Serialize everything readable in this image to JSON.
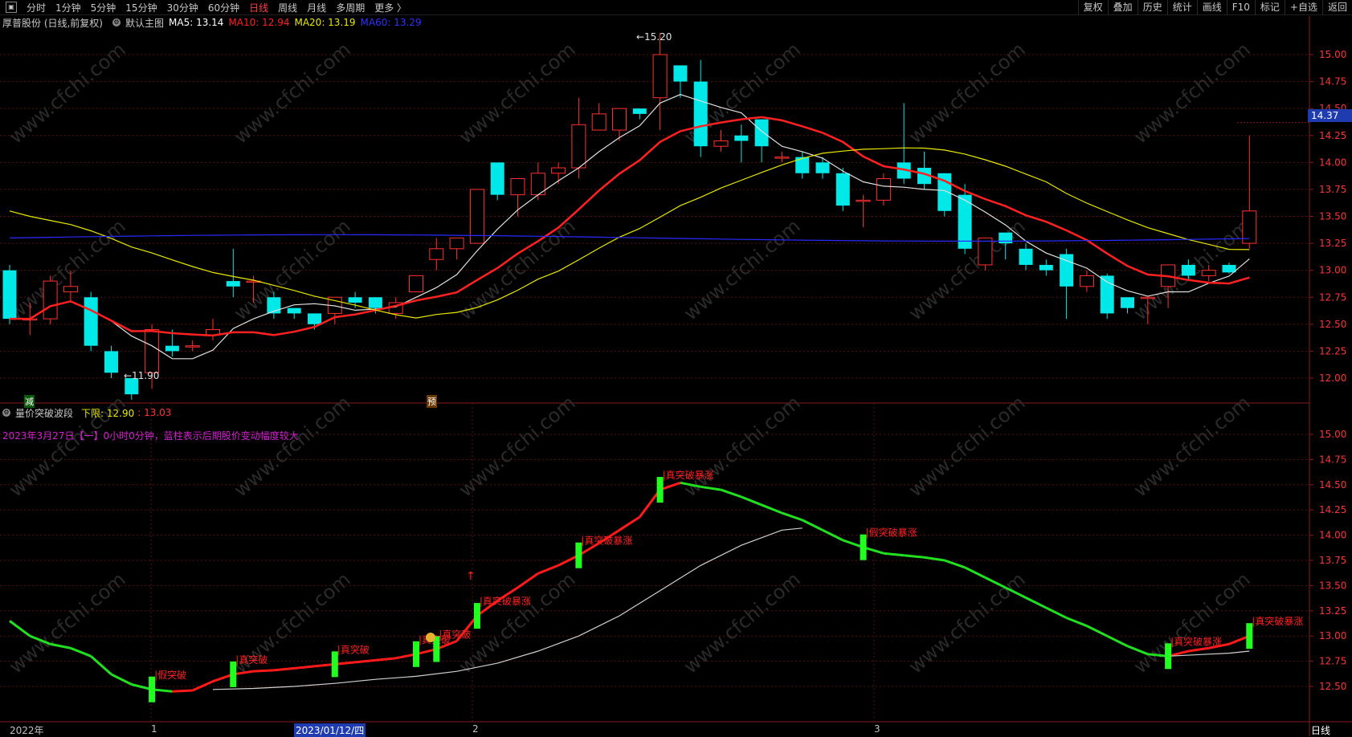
{
  "topbar": {
    "menu": [
      "分时",
      "1分钟",
      "5分钟",
      "15分钟",
      "30分钟",
      "60分钟",
      "日线",
      "周线",
      "月线",
      "多周期",
      "更多 〉"
    ],
    "active_index": 6,
    "right": [
      "复权",
      "叠加",
      "历史",
      "统计",
      "画线",
      "F10",
      "标记",
      "+自选",
      "返回"
    ]
  },
  "main_info": {
    "stock": "厚普股份 (日线,前复权)",
    "chart_name": "默认主图",
    "ma5": "MA5: 13.14",
    "ma10": "MA10: 12.94",
    "ma20": "MA20: 13.19",
    "ma60": "MA60: 13.29",
    "colors": {
      "ma5": "#ffffff",
      "ma10": "#ff2020",
      "ma20": "#e8e800",
      "ma60": "#2020ff"
    }
  },
  "price_axis_top": [
    "15.00",
    "14.75",
    "14.50",
    "14.25",
    "14.00",
    "13.75",
    "13.50",
    "13.25",
    "13.00",
    "12.75",
    "12.50",
    "12.25",
    "12.00"
  ],
  "price_axis_bottom": [
    "15.00",
    "14.75",
    "14.50",
    "14.25",
    "14.00",
    "13.75",
    "13.50",
    "13.25",
    "13.00",
    "12.75",
    "12.50"
  ],
  "current_price": "14.37",
  "high_label": "15.20",
  "low_label": "11.90",
  "markers": {
    "jian": "减",
    "yu": "预"
  },
  "sub_info": {
    "name": "量价突破波段",
    "lower_label": "下限: 12.90",
    "lower_value": ": 13.03",
    "note": "2023年3月27日【一】0小时0分钟，蓝柱表示后期股价变动幅度较大"
  },
  "signals": [
    "假突破",
    "真突破",
    "真突破",
    "真突破",
    "真突破暴涨",
    "真突破暴涨",
    "真突破暴涨",
    "假突破暴涨",
    "真突破暴涨",
    "真突破暴涨"
  ],
  "date_axis": {
    "year": "2022年",
    "m1": "1",
    "selected": "2023/01/12/四",
    "m2": "2",
    "m3": "3"
  },
  "period_label": "日线",
  "watermark": "www.cfchi.com",
  "chart_data": {
    "type": "candlestick",
    "ylim": [
      11.8,
      15.3
    ],
    "candles": [
      [
        13.0,
        12.55,
        12.5,
        13.05
      ],
      [
        12.55,
        12.55,
        12.4,
        12.7
      ],
      [
        12.55,
        12.9,
        12.5,
        12.95
      ],
      [
        12.8,
        12.85,
        12.7,
        13.0
      ],
      [
        12.75,
        12.3,
        12.25,
        12.8
      ],
      [
        12.25,
        12.05,
        12.0,
        12.3
      ],
      [
        12.0,
        11.85,
        11.8,
        12.0
      ],
      [
        12.05,
        12.45,
        11.9,
        12.5
      ],
      [
        12.3,
        12.25,
        12.2,
        12.45
      ],
      [
        12.3,
        12.3,
        12.25,
        12.35
      ],
      [
        12.4,
        12.45,
        12.35,
        12.55
      ],
      [
        12.9,
        12.85,
        12.75,
        13.2
      ],
      [
        12.9,
        12.9,
        12.7,
        12.95
      ],
      [
        12.75,
        12.6,
        12.55,
        12.8
      ],
      [
        12.65,
        12.6,
        12.55,
        12.65
      ],
      [
        12.6,
        12.5,
        12.45,
        12.6
      ],
      [
        12.6,
        12.75,
        12.5,
        12.75
      ],
      [
        12.75,
        12.7,
        12.65,
        12.8
      ],
      [
        12.75,
        12.65,
        12.6,
        12.75
      ],
      [
        12.6,
        12.7,
        12.55,
        12.75
      ],
      [
        12.8,
        12.95,
        12.8,
        12.95
      ],
      [
        13.1,
        13.2,
        13.0,
        13.3
      ],
      [
        13.2,
        13.3,
        13.1,
        13.3
      ],
      [
        13.25,
        13.75,
        13.25,
        13.75
      ],
      [
        14.0,
        13.7,
        13.65,
        14.0
      ],
      [
        13.7,
        13.85,
        13.5,
        13.8
      ],
      [
        13.7,
        13.9,
        13.65,
        14.0
      ],
      [
        13.9,
        13.95,
        13.8,
        14.0
      ],
      [
        13.95,
        14.35,
        13.85,
        14.6
      ],
      [
        14.3,
        14.45,
        14.3,
        14.55
      ],
      [
        14.3,
        14.5,
        14.2,
        14.5
      ],
      [
        14.5,
        14.45,
        14.4,
        14.5
      ],
      [
        14.6,
        15.0,
        14.3,
        15.2
      ],
      [
        14.9,
        14.75,
        14.6,
        14.9
      ],
      [
        14.75,
        14.15,
        14.05,
        14.95
      ],
      [
        14.15,
        14.2,
        14.1,
        14.3
      ],
      [
        14.25,
        14.2,
        14.0,
        14.35
      ],
      [
        14.4,
        14.15,
        14.0,
        14.4
      ],
      [
        14.05,
        14.05,
        14.0,
        14.1
      ],
      [
        14.05,
        13.9,
        13.85,
        14.1
      ],
      [
        14.0,
        13.9,
        13.85,
        14.05
      ],
      [
        13.9,
        13.6,
        13.55,
        13.95
      ],
      [
        13.65,
        13.65,
        13.4,
        13.7
      ],
      [
        13.65,
        13.85,
        13.6,
        13.9
      ],
      [
        14.0,
        13.85,
        13.8,
        14.55
      ],
      [
        13.95,
        13.8,
        13.75,
        14.1
      ],
      [
        13.9,
        13.55,
        13.5,
        13.9
      ],
      [
        13.7,
        13.2,
        13.15,
        13.8
      ],
      [
        13.05,
        13.3,
        13.0,
        13.3
      ],
      [
        13.35,
        13.25,
        13.1,
        13.35
      ],
      [
        13.2,
        13.05,
        13.0,
        13.25
      ],
      [
        13.05,
        13.0,
        12.95,
        13.1
      ],
      [
        13.15,
        12.85,
        12.55,
        13.2
      ],
      [
        12.85,
        12.95,
        12.8,
        13.0
      ],
      [
        12.95,
        12.6,
        12.55,
        12.97
      ],
      [
        12.75,
        12.65,
        12.6,
        12.75
      ],
      [
        12.75,
        12.75,
        12.5,
        12.75
      ],
      [
        12.85,
        13.05,
        12.65,
        13.05
      ],
      [
        13.05,
        12.95,
        12.9,
        13.1
      ],
      [
        12.95,
        13.0,
        12.9,
        13.05
      ],
      [
        13.05,
        12.98,
        12.97,
        13.07
      ],
      [
        13.25,
        13.55,
        13.2,
        14.25
      ]
    ]
  }
}
